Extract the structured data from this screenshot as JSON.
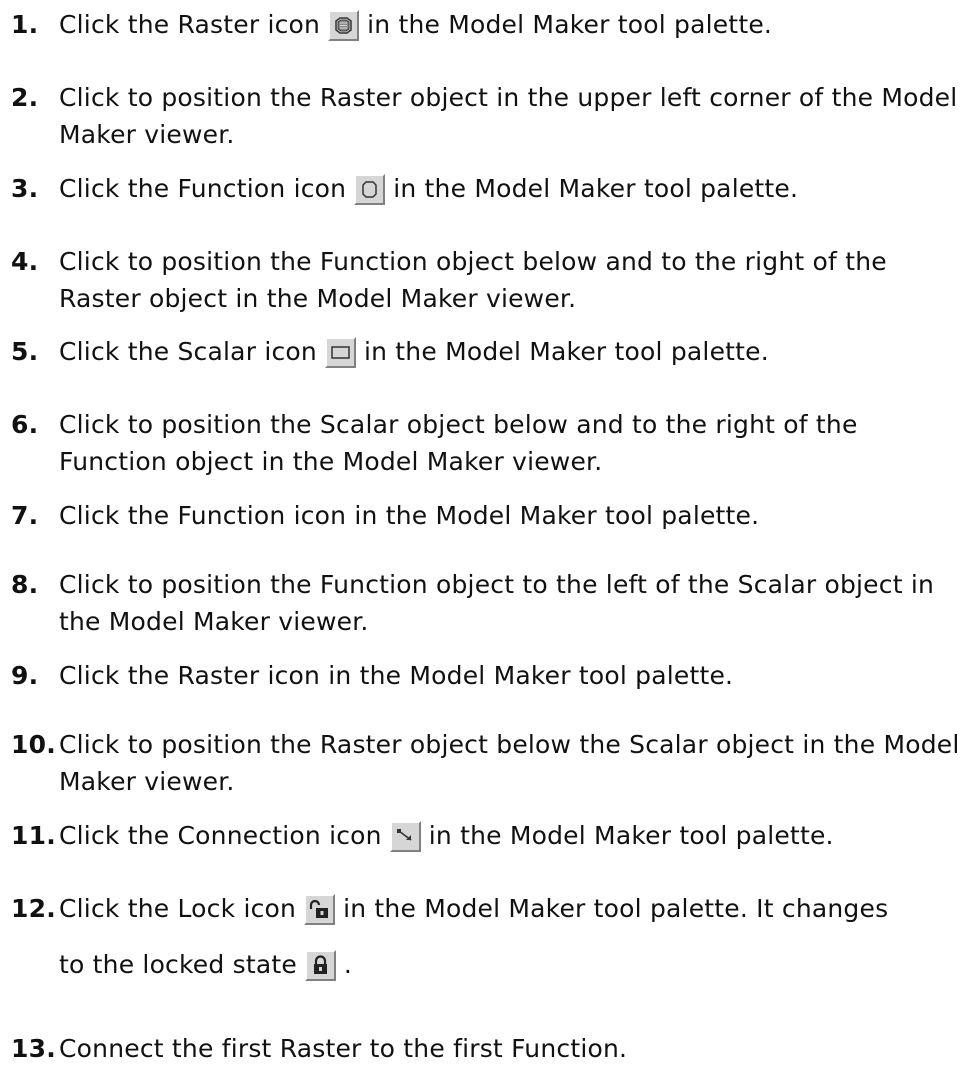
{
  "steps": [
    {
      "num": "1.",
      "before": "Click the Raster icon",
      "after": "in the Model Maker tool palette.",
      "icon": "raster-icon"
    },
    {
      "num": "2.",
      "text": "Click to position the Raster object in the upper left corner of the Model Maker viewer."
    },
    {
      "num": "3.",
      "before": "Click the Function icon",
      "after": "in the Model Maker tool palette.",
      "icon": "function-icon"
    },
    {
      "num": "4.",
      "text": "Click to position the Function object below and to the right of the Raster object in the Model Maker viewer."
    },
    {
      "num": "5.",
      "before": "Click the Scalar icon",
      "after": "in the Model Maker tool palette.",
      "icon": "scalar-icon"
    },
    {
      "num": "6.",
      "text": "Click to position the Scalar object below and to the right of the Function object in the Model Maker viewer."
    },
    {
      "num": "7.",
      "text": "Click the Function icon in the Model Maker tool palette."
    },
    {
      "num": "8.",
      "text": "Click to position the Function object to the left of the Scalar object in the Model Maker viewer."
    },
    {
      "num": "9.",
      "text": "Click the Raster icon in the Model Maker tool palette."
    },
    {
      "num": "10.",
      "text": "Click to position the Raster object below the Scalar object in the Model Maker viewer."
    },
    {
      "num": "11.",
      "before": "Click the Connection icon",
      "after": "in the Model Maker tool palette.",
      "icon": "connection-icon"
    },
    {
      "num": "12.",
      "before": "Click the Lock icon",
      "after": "in the Model Maker tool palette. It changes",
      "line2_before": "to the locked state",
      "line2_after": ".",
      "icon": "unlock-icon",
      "icon2": "lock-icon"
    },
    {
      "num": "13.",
      "text": "Connect the first Raster to the first Function."
    }
  ]
}
